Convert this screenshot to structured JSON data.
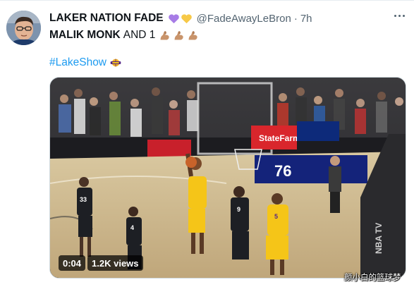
{
  "tweet": {
    "display_name": "LAKER NATION FADE",
    "name_emojis": [
      "purple-heart-icon",
      "yellow-heart-icon"
    ],
    "handle": "@FadeAwayLeBron",
    "separator": "·",
    "time": "7h",
    "text_bold": "MALIK MONK",
    "text_rest": "AND 1",
    "text_emojis": [
      "flexed-biceps-icon",
      "flexed-biceps-icon",
      "flexed-biceps-icon"
    ],
    "hashtag": "#LakeShow",
    "hashtag_icon": "lakers-logo-icon"
  },
  "media": {
    "type": "video",
    "duration": "0:04",
    "views": "1.2K views",
    "scene": {
      "sponsor_sign": "StateFarm",
      "scoreboard_number": "76",
      "jersey_numbers": [
        "33",
        "4",
        "9",
        "5"
      ],
      "side_text": "NBA TV"
    },
    "watermark": "颜小白的篮球梦"
  },
  "colors": {
    "link": "#1d9bf0",
    "muted": "#536471",
    "text": "#0f1419",
    "lakers_gold": "#f5c518",
    "lakers_purple": "#552583"
  }
}
